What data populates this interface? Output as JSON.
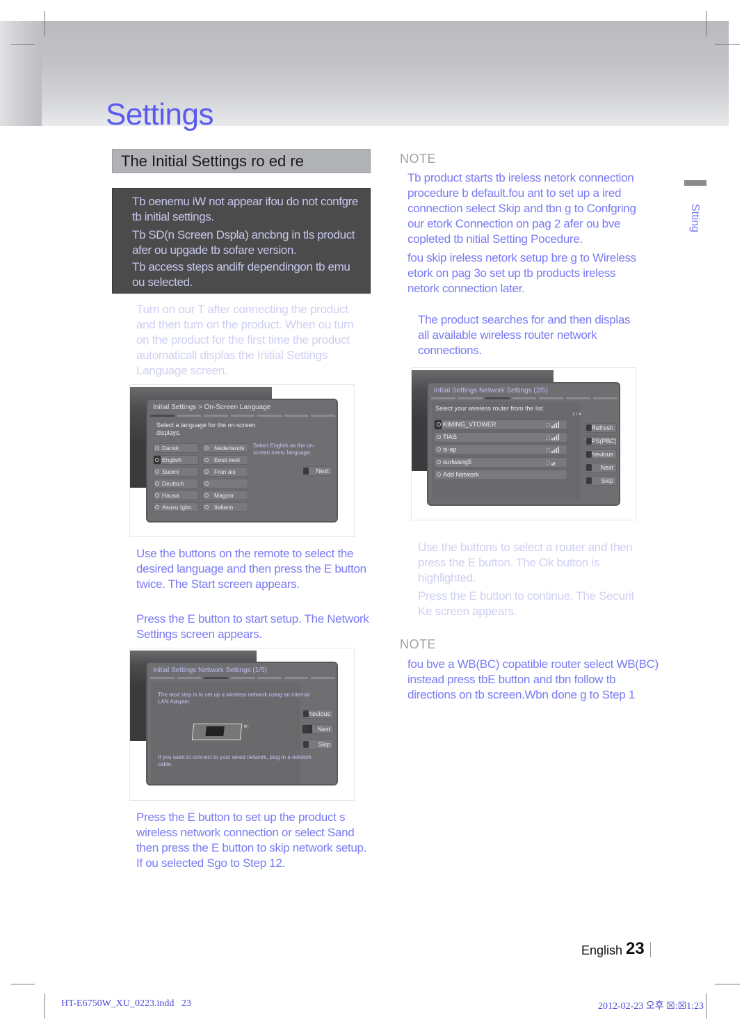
{
  "page": {
    "title": "Settings",
    "section_title": "The Initial Settings  ro ed re",
    "side_tab": "Stting",
    "footer": {
      "language": "English",
      "page_number": "23",
      "file_name": "HT-E6750W_XU_0223.indd",
      "file_page": "23",
      "timestamp": "2012-02-23  오후 ☒:☒1:23"
    }
  },
  "warning_box": [
    "Tb oenemu iW not appear ifou do not confgre tb initial settings.",
    "Tb SD(n Screen Dspla) ancbng in tls product afer ou upgade tb sofare version.",
    "Tb access steps andifr dependingon tb emu ou selected."
  ],
  "left_steps": {
    "step1": "Turn on our T  after connecting the product and then turn on the product. When ou turn on the product for the first time  the product automaticall displas the Initial Settings Language screen.",
    "step2_a": "Use the  buttons on the remote to select the desired language  and then press the E    button twice. The Start screen appears.",
    "step2_b": "Press the E    button to start setup. The Network Settings screen appears.",
    "step3": "Press the E    button to set up the product s wireless network connection or select  Sand then press the        E    button to skip network setup. If ou selected Sgo to Step 12."
  },
  "language_screen": {
    "title": "Initial Settings > On-Screen Language",
    "instruction": "Select a language for the on-screen displays.",
    "hint": "Select English as  the on-screen menu language.",
    "languages_col1": [
      "Dansk",
      "English",
      "Suomi",
      "Deutsch",
      "Hausa",
      "Asusu Igbo"
    ],
    "languages_col2": [
      "Nederlands",
      "Eesti keel",
      "Fran ais",
      "",
      "Magyar",
      "Italiano"
    ],
    "selected": "English",
    "next_label": "Next"
  },
  "network_screen_1": {
    "title": "Initial Settings Network Settings (1/5)",
    "text_top": "The next step is to set up a wireless network using an internal LAN Adapter.",
    "text_bottom": "If you want to connect to your wired network, plug in a network cable.",
    "buttons": [
      "Previous",
      "Next",
      "Skip"
    ]
  },
  "network_screen_2": {
    "title": "Initial Settings Network Settings (2/5)",
    "instruction": "Select your wireless router from the list.",
    "page_indicator": "1 / 4",
    "routers": [
      {
        "name": "KIMING_VTOWER",
        "signal": 4
      },
      {
        "name": "TIAS",
        "signal": 4
      },
      {
        "name": "si-ap",
        "signal": 4
      },
      {
        "name": "surlwang5",
        "signal": 2
      },
      {
        "name": "Add Network",
        "signal": 0
      }
    ],
    "buttons": [
      "Refresh",
      "WPS(PBC)",
      "Previous",
      "Next",
      "Skip"
    ]
  },
  "right_column": {
    "note1_label": "NOTE",
    "note1_items": [
      "Tb product starts tb ireless netork connection procedure b default.fou ant to set up a ired connection select Skip and tbn g to Confgring our etork Connection on pag 2 afer ou bve copleted tb nitial Setting Pocedure.",
      "fou skip ireless netork setup bre g to Wireless etork on pag 3o set up tb products ireless netork connection later."
    ],
    "step4": "The product searches for and then displas all available wireless router network connections.",
    "step5_a": "Use the  buttons to select a router  and then press the E    button. The Ok button is highlighted.",
    "step5_b": "Press the E    button to continue. The Securit Ke screen appears.",
    "note2_label": "NOTE",
    "note2_text": "fou bve a WB(BC) copatible router select WB(BC) instead press tbE     button and tbn follow tb directions on tb screen.Wbn done g to Step 1"
  },
  "colors": {
    "accent_blue": "#5a5af0",
    "body_blue": "#6b6bf0",
    "faint_blue": "#cfcff4",
    "dark_box": "#4b4b4b",
    "section_bar": "#b1b2b5"
  }
}
